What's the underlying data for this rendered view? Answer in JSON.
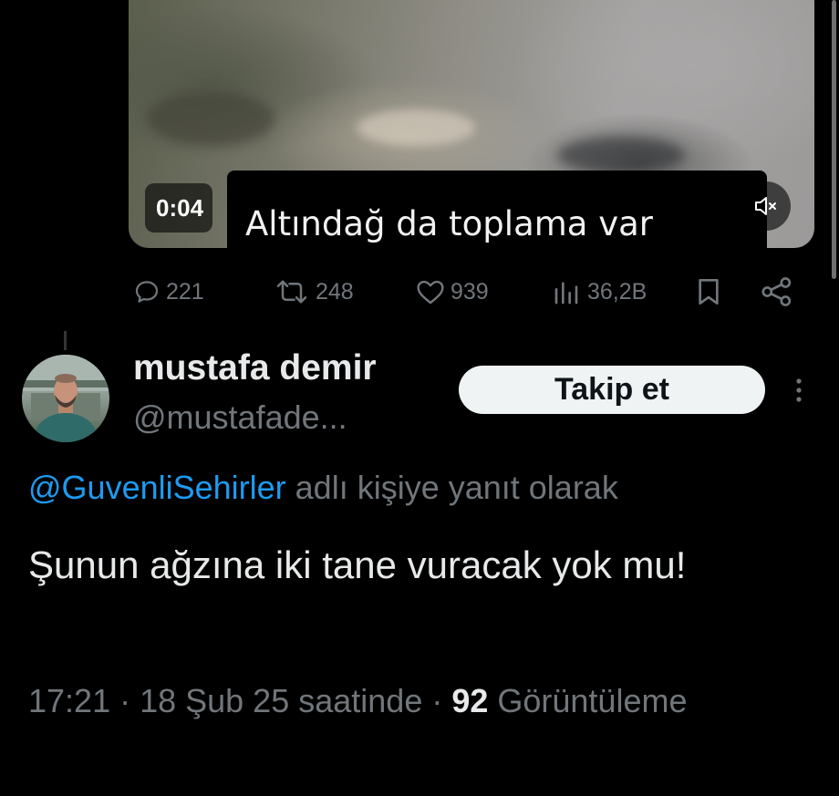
{
  "video": {
    "timestamp": "0:04",
    "subtitle": "Altındağ da toplama var",
    "mute_icon": "speaker-muted-icon"
  },
  "actions": {
    "replies": "221",
    "reposts": "248",
    "likes": "939",
    "views": "36,2B",
    "icons": [
      "reply-icon",
      "repost-icon",
      "like-icon",
      "views-icon",
      "bookmark-icon",
      "share-icon"
    ]
  },
  "user": {
    "display_name": "mustafa demir",
    "handle": "@mustafade...",
    "follow_label": "Takip et"
  },
  "reply": {
    "mention": "@GuvenliSehirler",
    "suffix": " adlı kişiye yanıt olarak"
  },
  "tweet": {
    "text": "Şunun ağzına iki tane vuracak yok mu!"
  },
  "meta": {
    "timestamp": "17:21 · 18 Şub 25 saatinde · ",
    "view_count": "92",
    "view_label": " Görüntüleme"
  },
  "colors": {
    "background": "#000000",
    "text_primary": "#e7e9ea",
    "text_secondary": "#71767b",
    "link": "#1d9bf0",
    "follow_button": "#eff3f4"
  }
}
